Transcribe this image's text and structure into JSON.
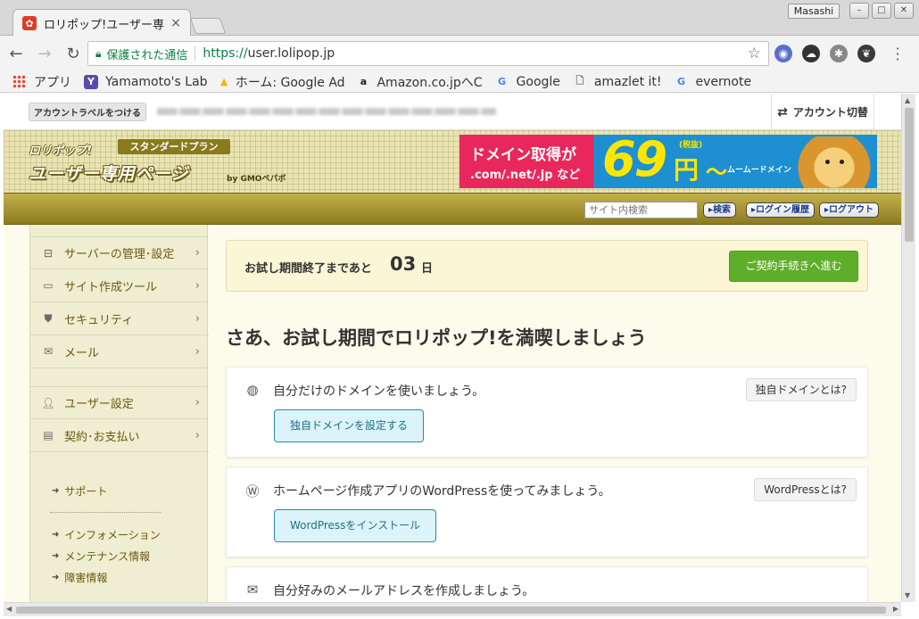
{
  "browser": {
    "tab_title": "ロリポップ!ユーザー専",
    "tab_close": "×",
    "profile_name": "Masashi",
    "window_buttons": {
      "min": "–",
      "max": "□",
      "close": "✕"
    },
    "url_secure_label": "保護された通信",
    "url_scheme": "https://",
    "url_host": "user.lolipop.jp",
    "icons": [
      "back-arrow-icon",
      "forward-arrow-icon",
      "reload-icon",
      "lock-icon",
      "star-icon",
      "menu-dots-icon"
    ],
    "bookmarks": [
      {
        "label": "アプリ",
        "icon": "apps-grid-icon"
      },
      {
        "label": "Yamamoto's Lab",
        "icon": "y-icon"
      },
      {
        "label": "ホーム: Google Ad",
        "icon": "google-ads-icon"
      },
      {
        "label": "Amazon.co.jpへC",
        "icon": "amazon-icon"
      },
      {
        "label": "Google",
        "icon": "google-icon"
      },
      {
        "label": "amazlet it!",
        "icon": "page-icon"
      },
      {
        "label": "evernote",
        "icon": "google-icon"
      }
    ]
  },
  "account_bar": {
    "label_button": "アカウントラベルをつける",
    "switch_label": "アカウント切替"
  },
  "banner": {
    "logo_top": "ロリポップ!",
    "plan_badge": "スタンダードプラン",
    "logo_main": "ユーザー専用ページ",
    "logo_by": "by GMOペパボ",
    "ad": {
      "line1": "ドメイン取得が",
      "line2": ".com/.net/.jp など",
      "price": "69",
      "yen": "円",
      "tax": "(税抜)",
      "tilde": "～",
      "brand": "ムームードメイン"
    }
  },
  "toolstrip": {
    "search_placeholder": "サイト内検索",
    "search_button": "▸検索",
    "history_button": "▸ログイン履歴",
    "logout_button": "▸ログアウト"
  },
  "sidebar": {
    "items": [
      {
        "label": "サーバーの管理･設定",
        "icon": "server-icon"
      },
      {
        "label": "サイト作成ツール",
        "icon": "laptop-icon"
      },
      {
        "label": "セキュリティ",
        "icon": "shield-icon"
      },
      {
        "label": "メール",
        "icon": "envelope-icon"
      },
      {
        "label": "ユーザー設定",
        "icon": "user-icon"
      },
      {
        "label": "契約･お支払い",
        "icon": "credit-card-icon"
      }
    ],
    "links": [
      "サポート",
      "インフォメーション",
      "メンテナンス情報",
      "障害情報"
    ]
  },
  "trial": {
    "text": "お試し期間終了まであと",
    "days": "03",
    "unit": "日",
    "button": "ご契約手続きへ進む"
  },
  "main": {
    "heading": "さあ、お試し期間でロリポップ!を満喫しましょう",
    "cards": [
      {
        "text": "自分だけのドメインを使いましょう。",
        "icon": "globe-icon",
        "help": "独自ドメインとは?",
        "action": "独自ドメインを設定する"
      },
      {
        "text": "ホームページ作成アプリのWordPressを使ってみましょう。",
        "icon": "wordpress-icon",
        "help": "WordPressとは?",
        "action": "WordPressをインストール"
      },
      {
        "text": "自分好みのメールアドレスを作成しましょう。",
        "icon": "envelope-icon"
      }
    ]
  },
  "colors": {
    "accent_gold": "#8c7b1f",
    "sidebar_bg": "#efedd2",
    "trial_button": "#5fae2b",
    "action_button_border": "#2d8aa6",
    "secure_green": "#0b8043"
  }
}
